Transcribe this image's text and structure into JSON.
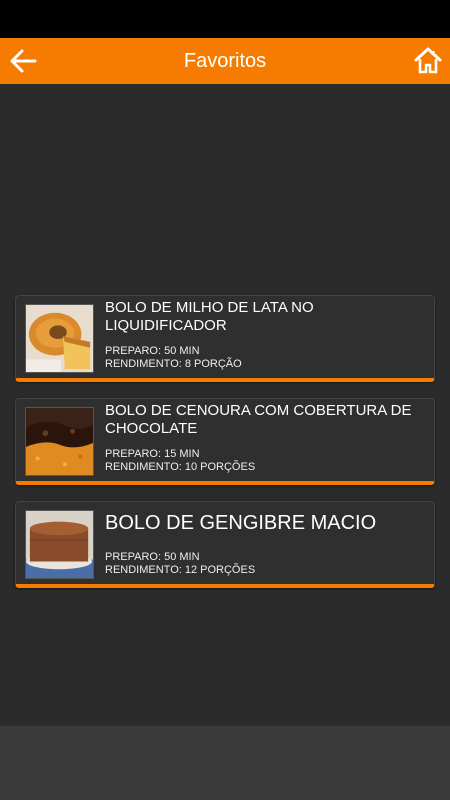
{
  "header": {
    "title": "Favoritos",
    "back_icon": "arrow-left-icon",
    "home_icon": "home-icon",
    "bar_color": "#f57c00"
  },
  "recipes": [
    {
      "title": "BOLO DE MILHO DE LATA NO LIQUIDIFICADOR",
      "preparo": "PREPARO: 50 MIN",
      "rendimento": "RENDIMENTO: 8 PORÇÃO",
      "image": "corn-cake-photo"
    },
    {
      "title": "BOLO DE CENOURA COM COBERTURA DE CHOCOLATE",
      "preparo": "PREPARO: 15 MIN",
      "rendimento": "RENDIMENTO: 10 PORÇÕES",
      "image": "carrot-cake-photo"
    },
    {
      "title": "BOLO DE GENGIBRE MACIO",
      "preparo": "PREPARO: 50 MIN",
      "rendimento": "RENDIMENTO: 12 PORÇÕES",
      "image": "ginger-cake-photo"
    }
  ]
}
